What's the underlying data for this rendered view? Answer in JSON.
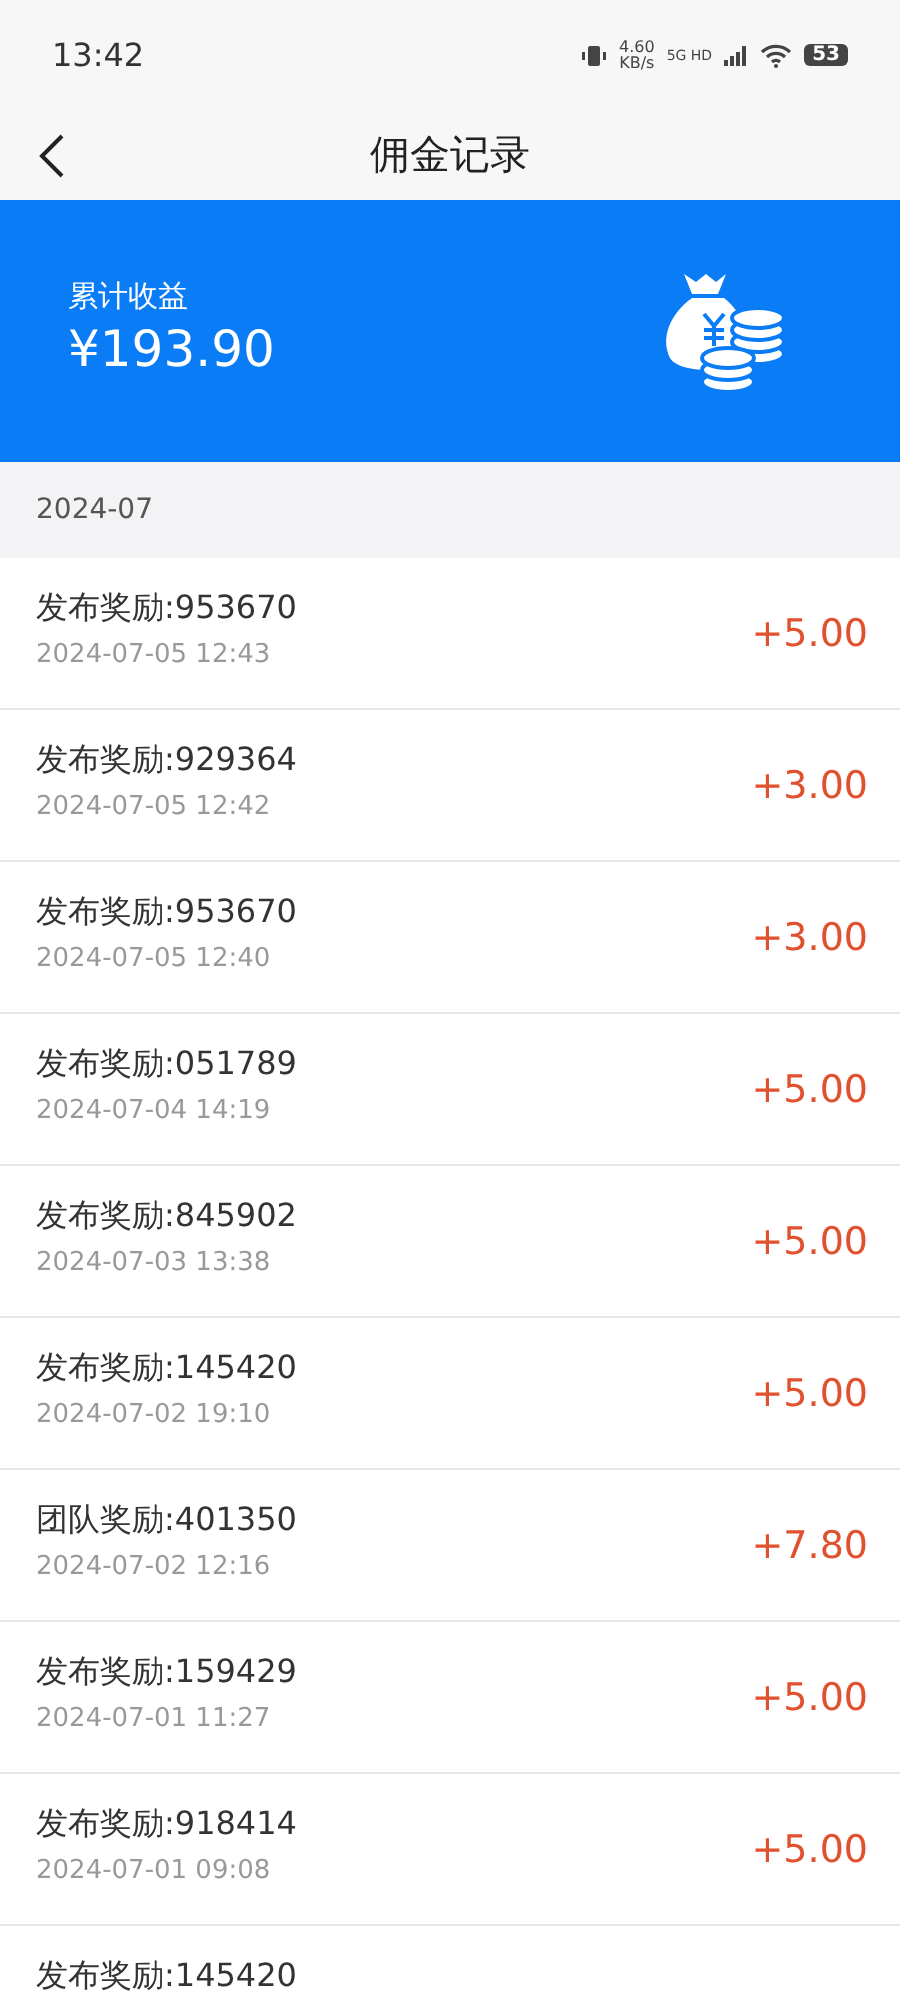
{
  "status_bar": {
    "time": "13:42",
    "speed": "4.60",
    "speed_unit": "KB/s",
    "network": "5G HD",
    "battery": "53"
  },
  "nav": {
    "title": "佣金记录"
  },
  "summary": {
    "label": "累计收益",
    "amount": "¥193.90"
  },
  "month": "2024-07",
  "records": [
    {
      "title": "发布奖励:953670",
      "time": "2024-07-05 12:43",
      "amount": "+5.00"
    },
    {
      "title": "发布奖励:929364",
      "time": "2024-07-05 12:42",
      "amount": "+3.00"
    },
    {
      "title": "发布奖励:953670",
      "time": "2024-07-05 12:40",
      "amount": "+3.00"
    },
    {
      "title": "发布奖励:051789",
      "time": "2024-07-04 14:19",
      "amount": "+5.00"
    },
    {
      "title": "发布奖励:845902",
      "time": "2024-07-03 13:38",
      "amount": "+5.00"
    },
    {
      "title": "发布奖励:145420",
      "time": "2024-07-02 19:10",
      "amount": "+5.00"
    },
    {
      "title": "团队奖励:401350",
      "time": "2024-07-02 12:16",
      "amount": "+7.80"
    },
    {
      "title": "发布奖励:159429",
      "time": "2024-07-01 11:27",
      "amount": "+5.00"
    },
    {
      "title": "发布奖励:918414",
      "time": "2024-07-01 09:08",
      "amount": "+5.00"
    },
    {
      "title": "发布奖励:145420"
    }
  ]
}
